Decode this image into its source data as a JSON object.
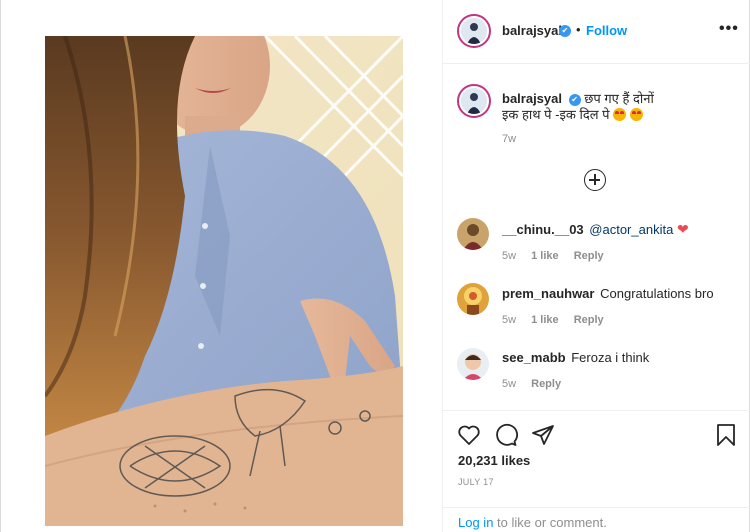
{
  "post": {
    "username": "balrajsyal",
    "verified_mark": "✔",
    "separator": "•",
    "follow_label": "Follow",
    "more_label": "•••"
  },
  "caption": {
    "username": "balrajsyal",
    "line1": "छप गए हैं दोनों",
    "line2": "इक हाथ पे -इक दिल पे",
    "time": "7w"
  },
  "comments": [
    {
      "username": "__chinu.__03",
      "text": "@actor_ankita",
      "emoji": "❤",
      "age": "5w",
      "likes": "1 like",
      "reply": "Reply"
    },
    {
      "username": "prem_nauhwar",
      "text": "Congratulations bro",
      "age": "5w",
      "likes": "1 like",
      "reply": "Reply"
    },
    {
      "username": "see_mabb",
      "text": "Feroza i think",
      "age": "5w",
      "reply": "Reply"
    }
  ],
  "actions": {
    "likes": "20,231 likes",
    "date": "JULY 17",
    "login_link": "Log in",
    "login_rest": " to like or comment."
  },
  "icons": {
    "like": "heart-outline-icon",
    "comment": "speech-bubble-icon",
    "share": "paper-plane-icon",
    "save": "bookmark-icon",
    "load_more": "plus-circle-icon"
  },
  "colors": {
    "link_blue": "#0095f6",
    "verified_blue": "#3897f0",
    "heart_red": "#ed4956",
    "muted": "#8e8e8e"
  }
}
